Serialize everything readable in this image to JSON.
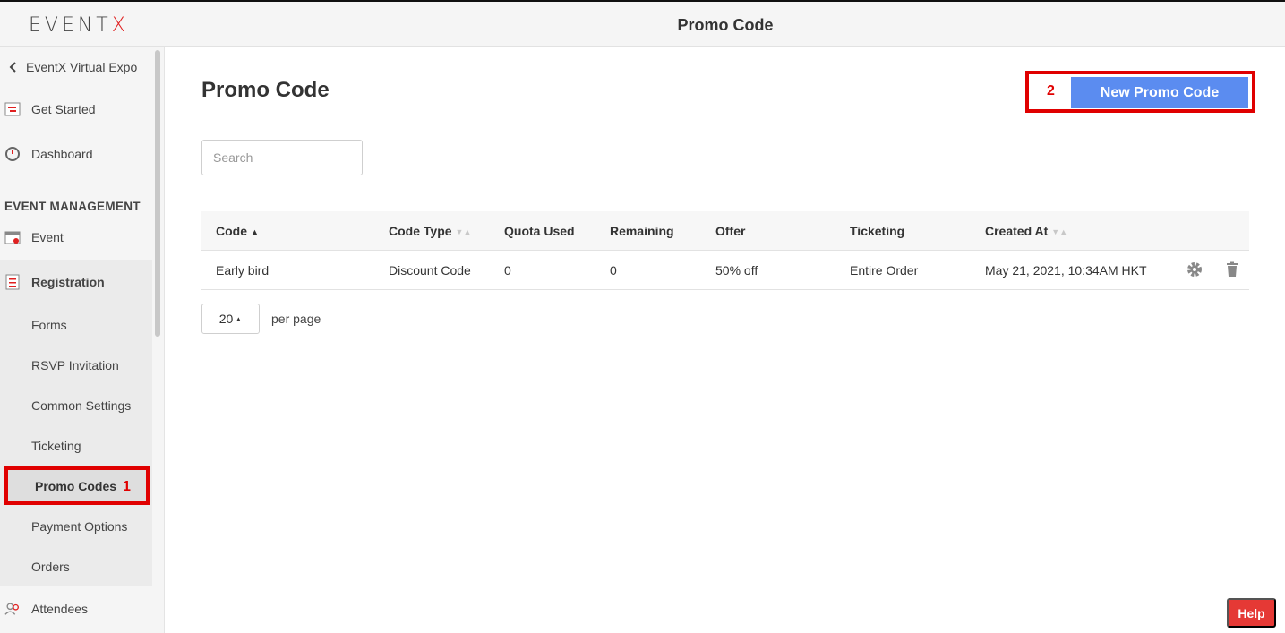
{
  "header": {
    "logo": "EVENT",
    "logo_x": "X",
    "title": "Promo Code"
  },
  "sidebar": {
    "back_label": "EventX Virtual Expo",
    "items": [
      {
        "label": "Get Started",
        "icon": "flag-icon"
      },
      {
        "label": "Dashboard",
        "icon": "gauge-icon"
      }
    ],
    "section_heading": "EVENT MANAGEMENT",
    "event_label": "Event",
    "registration_label": "Registration",
    "registration_sub": [
      "Forms",
      "RSVP Invitation",
      "Common Settings",
      "Ticketing",
      "Promo Codes",
      "Payment Options",
      "Orders"
    ],
    "attendees_label": "Attendees",
    "annotation_1": "1"
  },
  "main": {
    "title": "Promo Code",
    "new_button": "New Promo Code",
    "annotation_2": "2",
    "search_placeholder": "Search",
    "columns": [
      "Code",
      "Code Type",
      "Quota Used",
      "Remaining",
      "Offer",
      "Ticketing",
      "Created At"
    ],
    "rows": [
      {
        "code": "Early bird",
        "type": "Discount Code",
        "quota_used": "0",
        "remaining": "0",
        "offer": "50% off",
        "ticketing": "Entire Order",
        "created_at": "May 21, 2021, 10:34AM HKT"
      }
    ],
    "page_size": "20",
    "per_page_label": "per page"
  },
  "help_label": "Help",
  "colors": {
    "accent": "#5b8cf0",
    "annotation": "#e00000",
    "help": "#e53935"
  }
}
